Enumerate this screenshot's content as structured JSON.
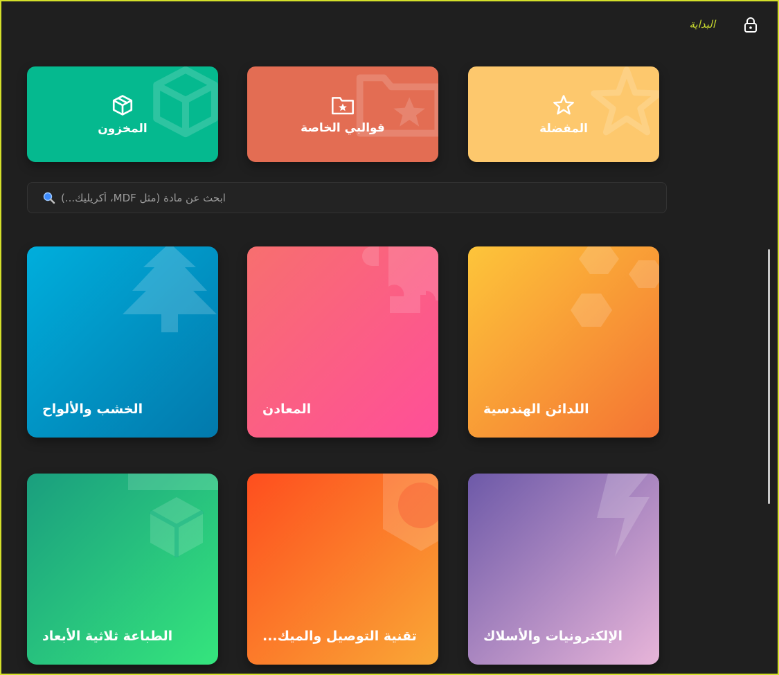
{
  "header": {
    "title": "البداية",
    "lock_icon": "lock-icon"
  },
  "quick_cards": [
    {
      "label": "المخزون",
      "icon": "box-icon",
      "color": "#05b98f"
    },
    {
      "label": "قوالبي الخاصة",
      "icon": "folder-star-icon",
      "color": "#e36d53"
    },
    {
      "label": "المفضلة",
      "icon": "star-icon",
      "color": "#fdc86d"
    }
  ],
  "search": {
    "placeholder": "(...أكريليك ،MDF مثل) ابحث عن مادة",
    "value": "",
    "icon": "search-icon"
  },
  "categories": [
    {
      "label": "الخشب والألواح",
      "icon": "tree-icon",
      "colors": [
        "#00aedc",
        "#0279ac"
      ]
    },
    {
      "label": "المعادن",
      "icon": "bolt-nut-icon",
      "colors": [
        "#f76f6f",
        "#ff4f98"
      ]
    },
    {
      "label": "اللدائن الهندسية",
      "icon": "hexagon-icon",
      "colors": [
        "#fdc53a",
        "#f47333"
      ]
    },
    {
      "label": "الطباعة ثلاثية الأبعاد",
      "icon": "cube-icon",
      "colors": [
        "#1a9e7e",
        "#35e57d"
      ]
    },
    {
      "label": "...تقنية التوصيل والميك",
      "icon": "hex-nut-icon",
      "colors": [
        "#fe4e1e",
        "#f9a836"
      ]
    },
    {
      "label": "الإلكترونيات والأسلاك",
      "icon": "lightning-icon",
      "colors": [
        "#6d59a8",
        "#e8b5d9"
      ]
    }
  ]
}
